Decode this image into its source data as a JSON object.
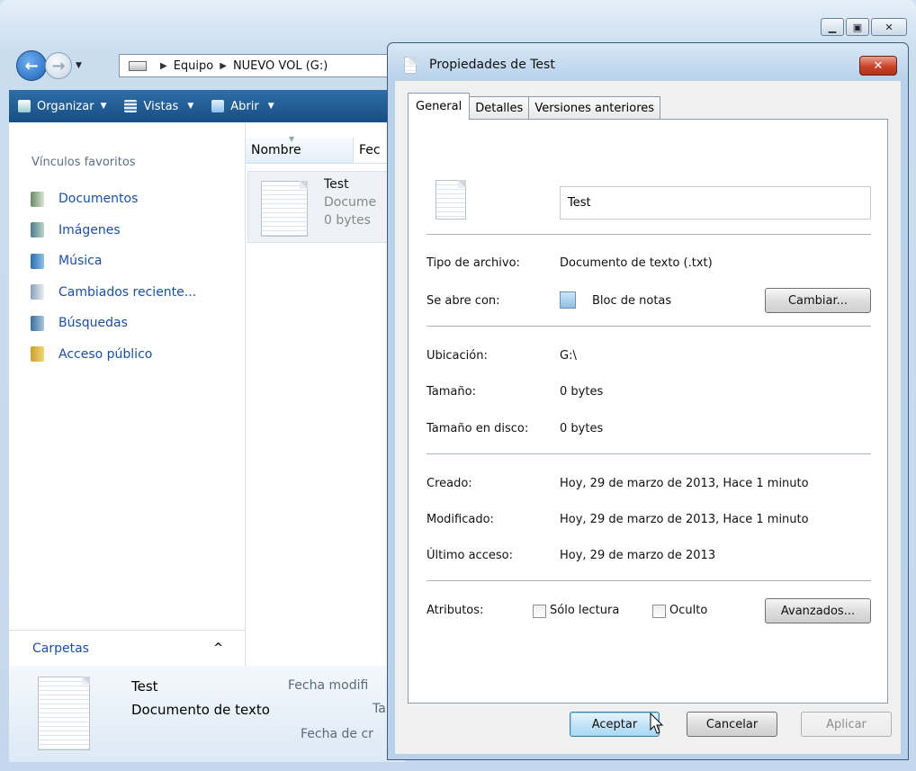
{
  "explorer": {
    "window_buttons": [
      "minimize",
      "maximize",
      "close"
    ],
    "address": {
      "segments": [
        "Equipo",
        "NUEVO VOL (G:)"
      ]
    },
    "toolbar": {
      "organize": "Organizar",
      "views": "Vistas",
      "open": "Abrir"
    },
    "sidebar": {
      "header": "Vínculos favoritos",
      "items": [
        {
          "label": "Documentos",
          "icon": "documents-icon"
        },
        {
          "label": "Imágenes",
          "icon": "pictures-icon"
        },
        {
          "label": "Música",
          "icon": "music-icon"
        },
        {
          "label": "Cambiados reciente...",
          "icon": "recent-icon"
        },
        {
          "label": "Búsquedas",
          "icon": "searches-icon"
        },
        {
          "label": "Acceso público",
          "icon": "public-folder-icon"
        }
      ],
      "folders_label": "Carpetas"
    },
    "columns": {
      "name": "Nombre",
      "date": "Fec"
    },
    "file": {
      "name": "Test",
      "type": "Docume",
      "size": "0 bytes"
    },
    "details": {
      "name": "Test",
      "type": "Documento de texto",
      "label_modified": "Fecha modifi",
      "label_size": "Ta",
      "label_created": "Fecha de cr"
    }
  },
  "dialog": {
    "title": "Propiedades de Test",
    "tabs": [
      "General",
      "Detalles",
      "Versiones anteriores"
    ],
    "filename": "Test",
    "file_type_label": "Tipo de archivo:",
    "file_type_value": "Documento de texto (.txt)",
    "opens_with_label": "Se abre con:",
    "opens_with_value": "Bloc de notas",
    "change_button": "Cambiar...",
    "location_label": "Ubicación:",
    "location_value": "G:\\",
    "size_label": "Tamaño:",
    "size_value": "0 bytes",
    "size_on_disk_label": "Tamaño en disco:",
    "size_on_disk_value": "0 bytes",
    "created_label": "Creado:",
    "created_value": "Hoy, 29 de marzo de 2013, Hace 1 minuto",
    "modified_label": "Modificado:",
    "modified_value": "Hoy, 29 de marzo de 2013, Hace 1 minuto",
    "accessed_label": "Último acceso:",
    "accessed_value": "Hoy, 29 de marzo de 2013",
    "attributes_label": "Atributos:",
    "readonly_label": "Sólo lectura",
    "readonly_checked": false,
    "hidden_label": "Oculto",
    "hidden_checked": false,
    "advanced_button": "Avanzados...",
    "ok_button": "Aceptar",
    "cancel_button": "Cancelar",
    "apply_button": "Aplicar"
  },
  "colors": {
    "link_blue": "#1b4fa0",
    "toolbar_blue": "#1f5a90",
    "close_red": "#c7442a"
  }
}
